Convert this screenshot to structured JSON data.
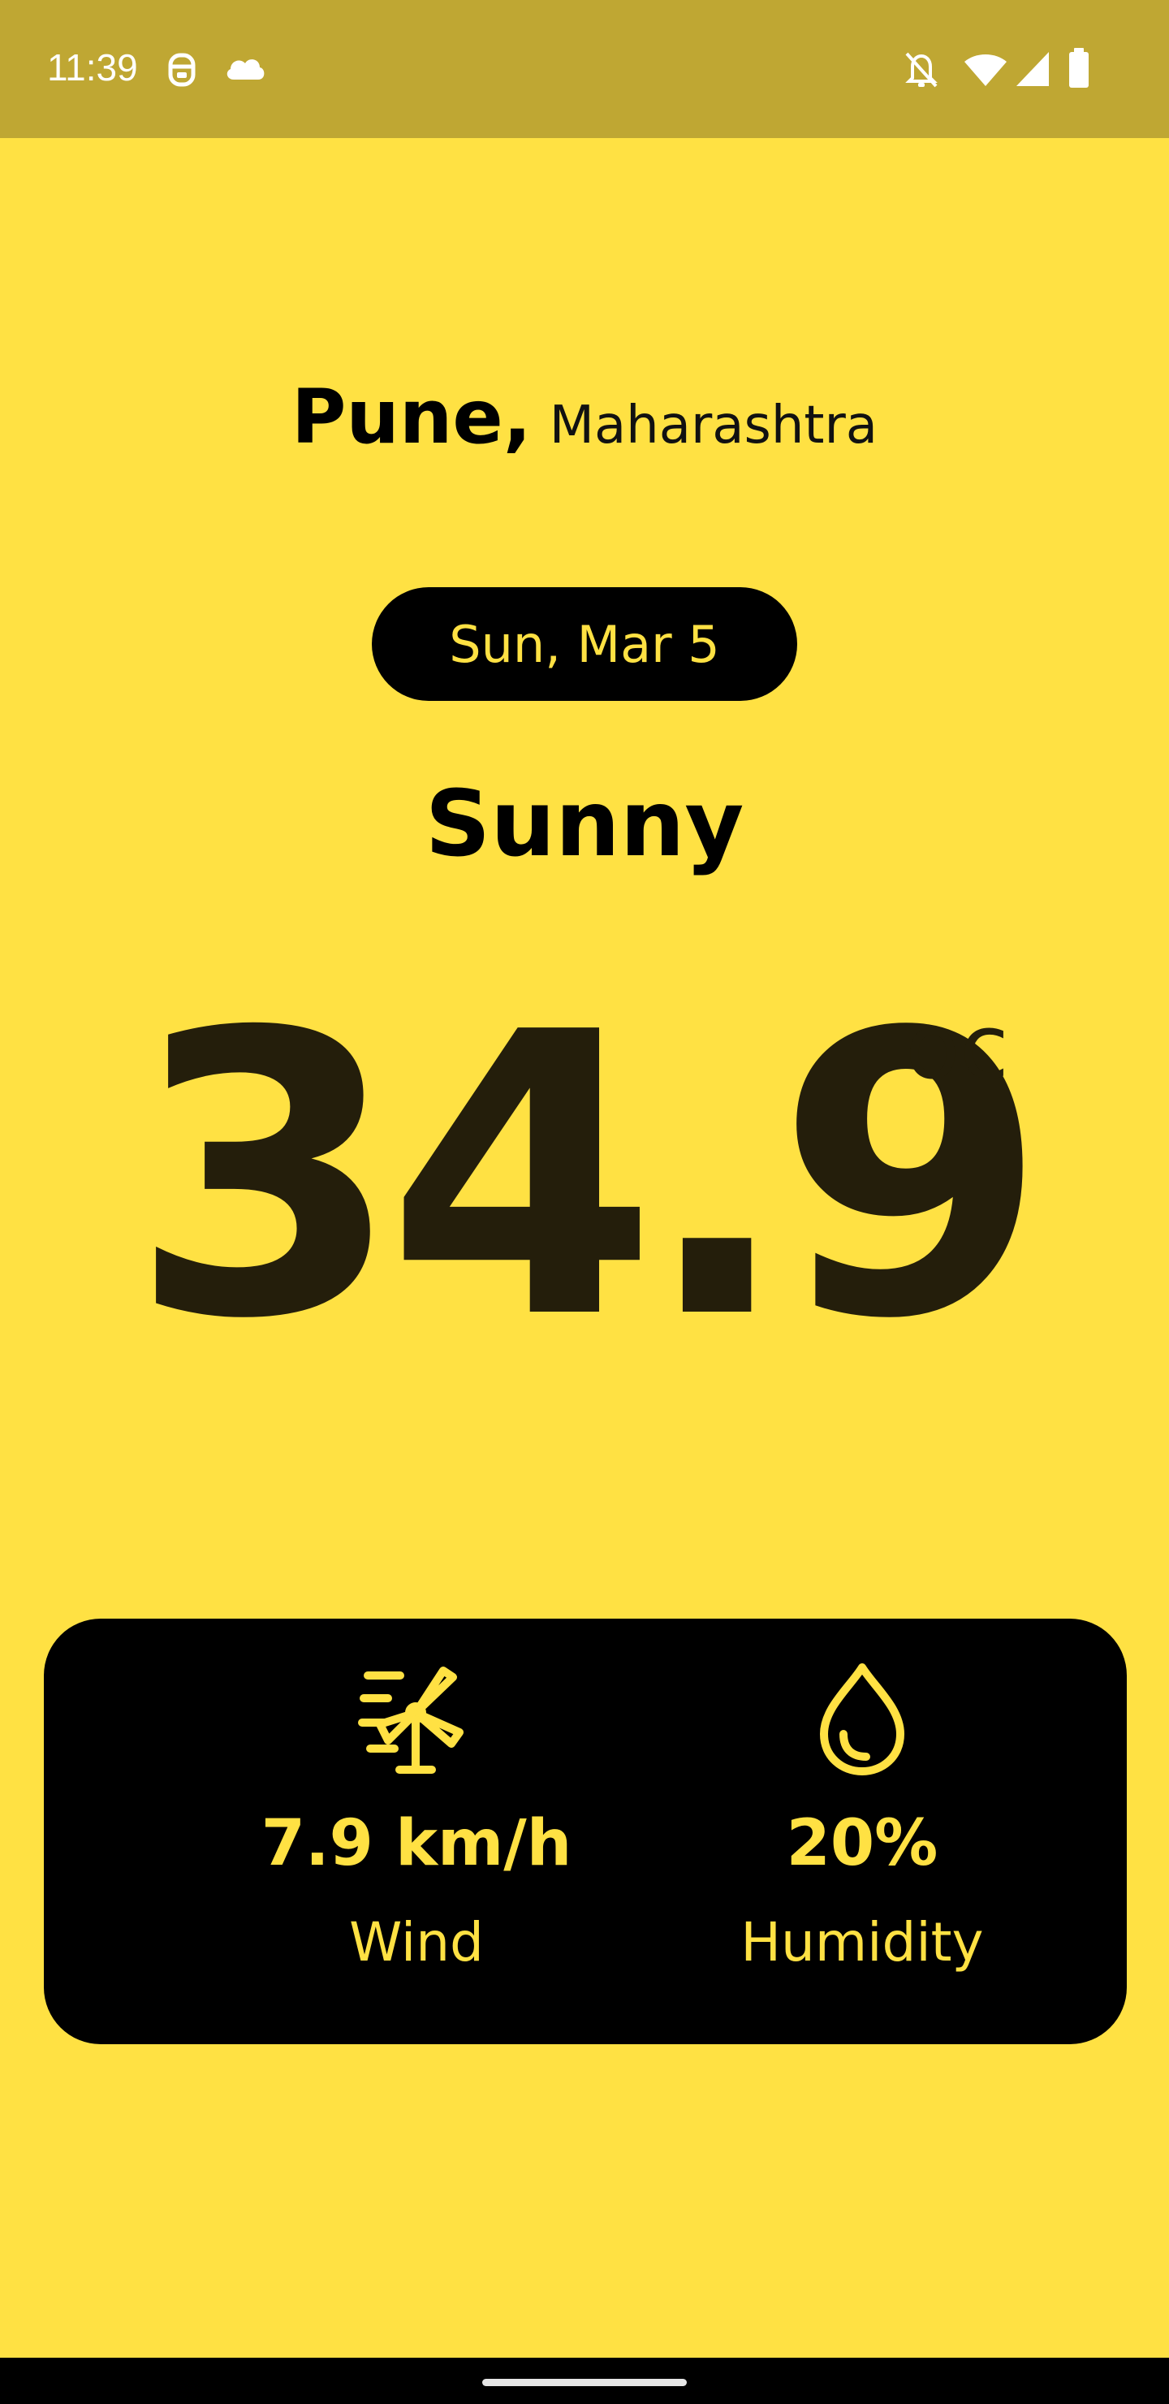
{
  "status_bar": {
    "time": "11:39",
    "left_icons": [
      "assistant-face-icon",
      "cloud-icon"
    ],
    "right_icons": [
      "bell-off-icon",
      "wifi-icon",
      "signal-icon",
      "battery-icon"
    ]
  },
  "weather": {
    "city": "Pune,",
    "state": "Maharashtra",
    "date": "Sun, Mar 5",
    "condition": "Sunny",
    "temperature": "34.9",
    "unit": "oc"
  },
  "stats": {
    "wind": {
      "value": "7.9 km/h",
      "label": "Wind",
      "icon": "wind-turbine-icon"
    },
    "humidity": {
      "value": "20%",
      "label": "Humidity",
      "icon": "water-drop-icon"
    }
  },
  "colors": {
    "status_bar_bg": "#BFA733",
    "app_bg": "#FFE143",
    "accent": "#FFE143",
    "card_bg": "#000000",
    "temperature_text": "#241E0B"
  }
}
